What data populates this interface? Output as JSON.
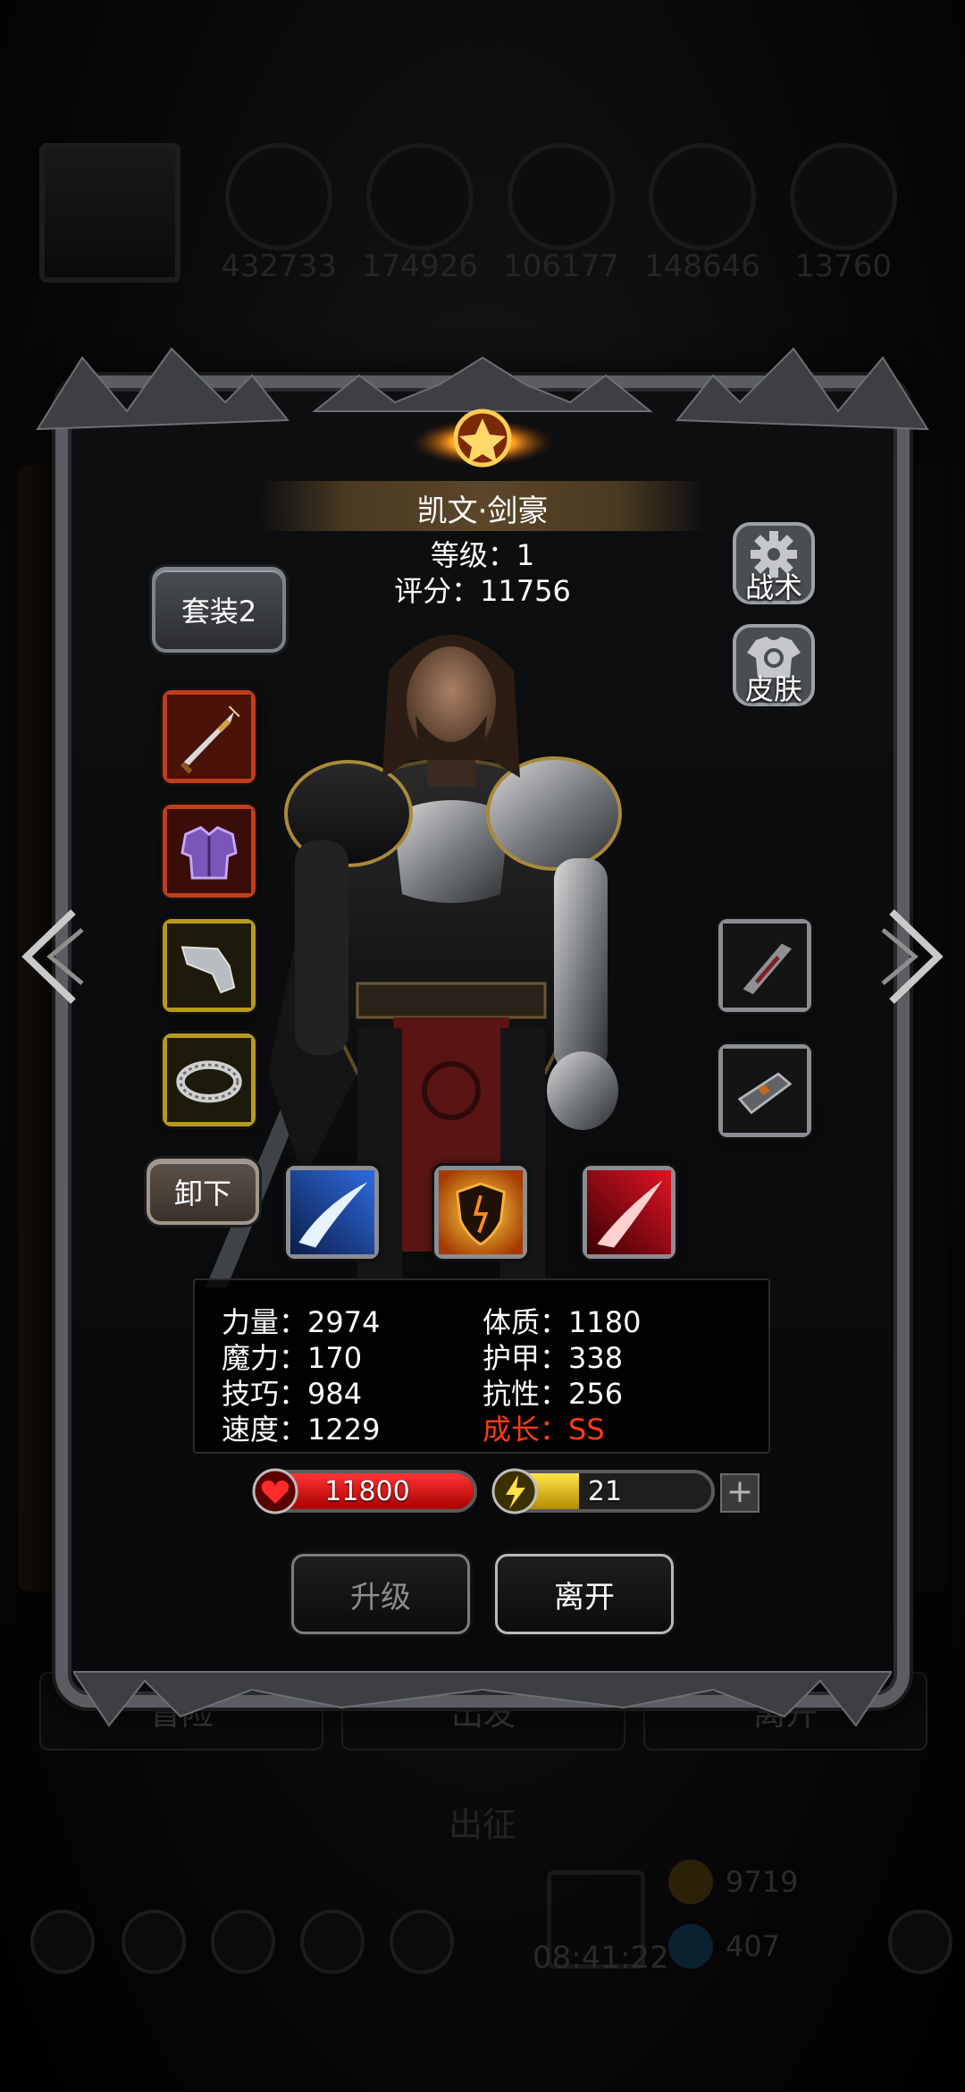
{
  "hud": {
    "resources": [
      "432733",
      "174926",
      "106177",
      "148646",
      "13760"
    ],
    "buttons": [
      "冒险",
      "出发",
      "离开"
    ],
    "section_title": "出征",
    "time": "08:41:22",
    "coins": [
      "9719",
      "407"
    ]
  },
  "hero": {
    "name": "凯文·剑豪",
    "level_text": "等级：1",
    "score_text": "评分：11756"
  },
  "buttons": {
    "set": "套装2",
    "tactics": "战术",
    "skin": "皮肤",
    "unequip": "卸下",
    "upgrade": "升级",
    "leave": "离开",
    "plus": "+"
  },
  "equipment": {
    "left": [
      "sword-icon",
      "armor-icon",
      "gauntlet-icon",
      "ring-icon"
    ],
    "right": [
      "blade-accessory-icon",
      "bracer-icon"
    ],
    "skills": [
      "wind-slash-icon",
      "fire-shield-icon",
      "crimson-slash-icon"
    ]
  },
  "stats": {
    "strength": "力量：2974",
    "magic": "魔力：170",
    "skill": "技巧：984",
    "speed": "速度：1229",
    "constitution": "体质：1180",
    "armor": "护甲：338",
    "resistance": "抗性：256",
    "growth": "成长：SS"
  },
  "bars": {
    "hp": "11800",
    "hp_fill": 1.0,
    "energy": "21",
    "energy_fill": 0.38
  },
  "colors": {
    "hp": "#d40000",
    "energy": "#f2cc1d",
    "growth": "#ff3c15",
    "title_bar": "#5b4629"
  }
}
